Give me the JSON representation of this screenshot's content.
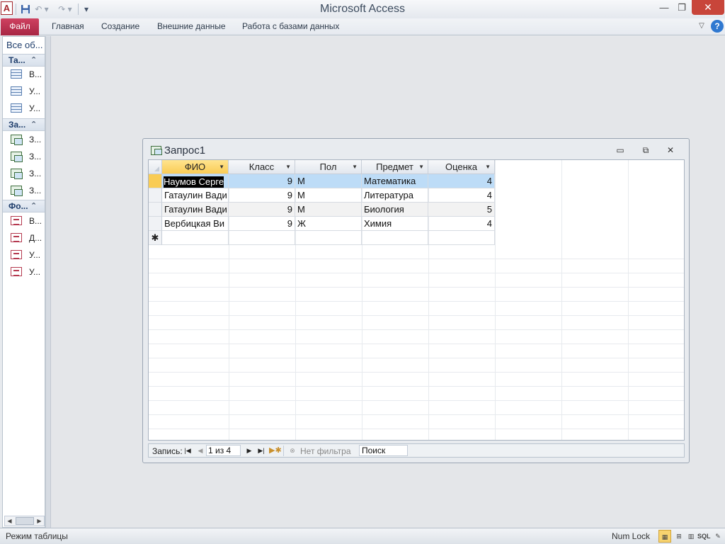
{
  "app": {
    "title": "Microsoft Access",
    "icon_letter": "A"
  },
  "ribbon": {
    "file": "Файл",
    "tabs": [
      "Главная",
      "Создание",
      "Внешние данные",
      "Работа с базами данных"
    ],
    "help": "?"
  },
  "nav": {
    "header": "Все об...",
    "groups": [
      {
        "label": "Та...",
        "items": [
          "В...",
          "У...",
          "У..."
        ],
        "icon": "table-icon"
      },
      {
        "label": "За...",
        "items": [
          "З...",
          "З...",
          "З...",
          "З..."
        ],
        "icon": "query-icon"
      },
      {
        "label": "Фо...",
        "items": [
          "В...",
          "Д...",
          "У...",
          "У..."
        ],
        "icon": "form-icon"
      }
    ]
  },
  "query_window": {
    "title": "Запрос1",
    "columns": [
      "ФИО",
      "Класс",
      "Пол",
      "Предмет",
      "Оценка"
    ],
    "rows": [
      {
        "fio": "Наумов Серге",
        "klass": "9",
        "pol": "М",
        "predmet": "Математика",
        "ocenka": "4"
      },
      {
        "fio": "Гатаулин Вади",
        "klass": "9",
        "pol": "М",
        "predmet": "Литература",
        "ocenka": "4"
      },
      {
        "fio": "Гатаулин Вади",
        "klass": "9",
        "pol": "М",
        "predmet": "Биология",
        "ocenka": "5"
      },
      {
        "fio": "Вербицкая Ви",
        "klass": "9",
        "pol": "Ж",
        "predmet": "Химия",
        "ocenka": "4"
      }
    ],
    "new_row_marker": "✱",
    "record_nav": {
      "label": "Запись:",
      "position": "1 из 4",
      "filter": "Нет фильтра",
      "search": "Поиск"
    }
  },
  "status": {
    "mode": "Режим таблицы",
    "numlock": "Num Lock",
    "views": {
      "sql": "SQL"
    }
  },
  "colors": {
    "file_tab": "#b8304f",
    "close_button": "#c8453a",
    "active_header": "#f9cc55",
    "row_highlight": "#bddcf7"
  }
}
